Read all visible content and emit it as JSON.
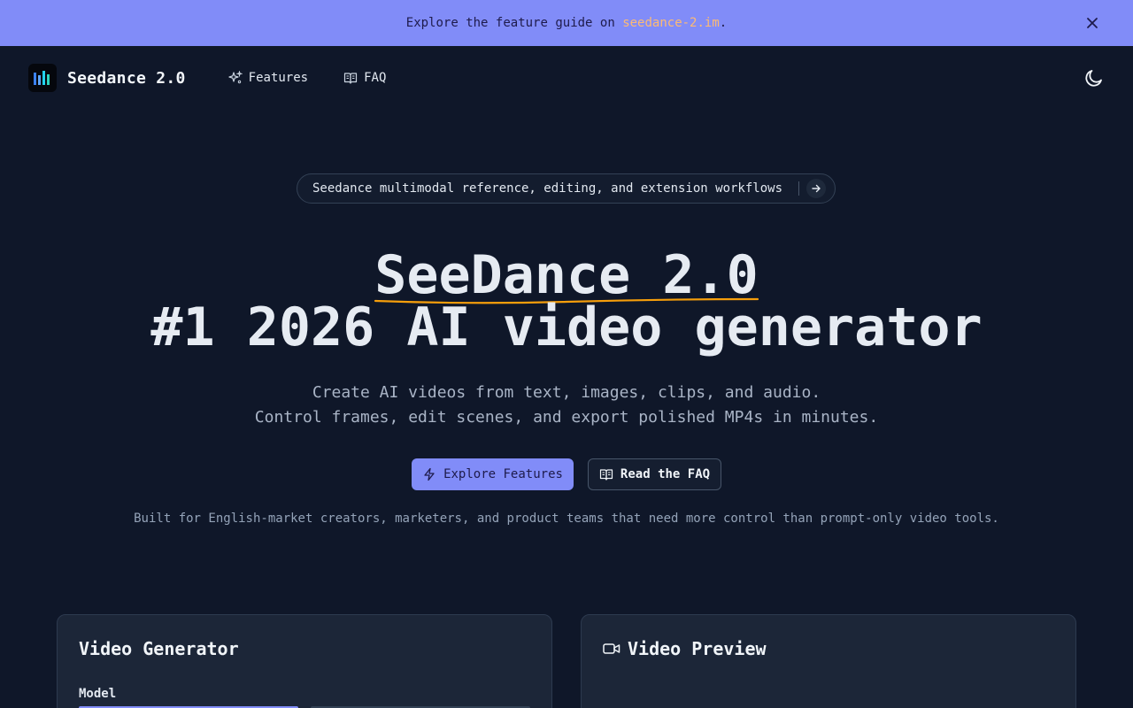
{
  "banner": {
    "prefix": "Explore the feature guide on ",
    "link_text": "seedance-2.im",
    "suffix": "."
  },
  "nav": {
    "brand": "Seedance 2.0",
    "features_label": "Features",
    "faq_label": "FAQ"
  },
  "hero": {
    "pill_text": "Seedance multimodal reference, editing, and extension workflows",
    "title_line1": "SeeDance 2.0",
    "title_line2": "#1 2026 AI video generator",
    "subtitle_line1": "Create AI videos from text, images, clips, and audio.",
    "subtitle_line2": "Control frames, edit scenes, and export polished MP4s in minutes.",
    "primary_cta": "Explore Features",
    "secondary_cta": "Read the FAQ",
    "tagline": "Built for English-market creators, marketers, and product teams that need more control than prompt-only video tools."
  },
  "cards": {
    "generator_title": "Video Generator",
    "model_label": "Model",
    "preview_title": "Video Preview"
  },
  "colors": {
    "accent": "#818cf8",
    "link": "#fdba74",
    "background": "#0f1729",
    "card": "#1c2638"
  },
  "icons": [
    "close-icon",
    "logo-icon",
    "sparkles-icon",
    "book-open-icon",
    "moon-icon",
    "arrow-right-icon",
    "zap-icon",
    "video-icon"
  ]
}
